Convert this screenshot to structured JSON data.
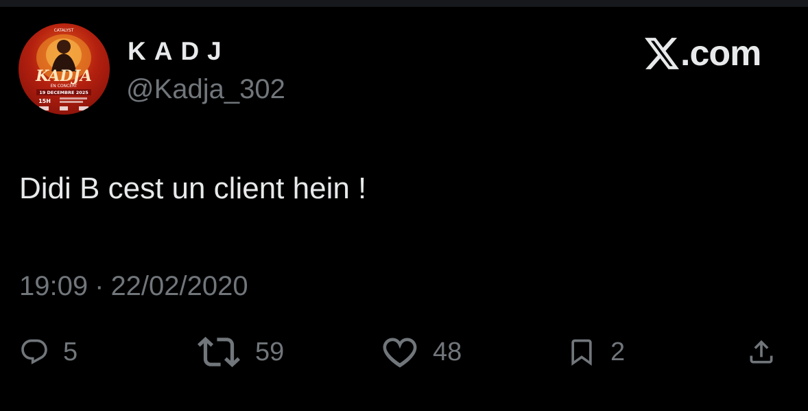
{
  "profile": {
    "display_name": "KADJ",
    "handle": "@Kadja_302",
    "avatar": {
      "poster_top_text": "CATALYST",
      "poster_title": "KADJA",
      "poster_subtitle": "EN CONCERT",
      "poster_date": "19 DECEMBRE 2025",
      "poster_time": "15H"
    }
  },
  "brand": {
    "text": ".com",
    "icon": "x-logo-icon"
  },
  "tweet": {
    "text": "Didi B cest un client hein !",
    "time": "19:09",
    "separator": "·",
    "date": "22/02/2020"
  },
  "actions": [
    {
      "icon": "reply-icon",
      "count": "5"
    },
    {
      "icon": "retweet-icon",
      "count": "59"
    },
    {
      "icon": "heart-icon",
      "count": "48"
    },
    {
      "icon": "bookmark-icon",
      "count": "2"
    },
    {
      "icon": "share-icon",
      "count": ""
    }
  ],
  "colors": {
    "background": "#000000",
    "primary_text": "#e7e9ea",
    "secondary_text": "#71767b",
    "avatar_red": "#b3200f",
    "avatar_orange": "#e65a1c"
  }
}
